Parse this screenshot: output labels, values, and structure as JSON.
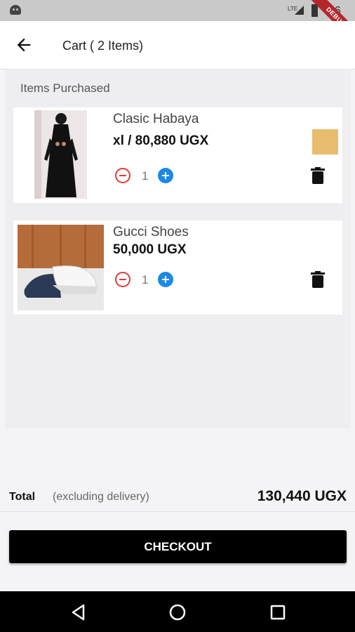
{
  "status_bar": {
    "time": "36",
    "network": "LTE"
  },
  "debug_banner": "DEBUG",
  "app_bar": {
    "title": "Cart ( 2 Items)"
  },
  "section_label": "Items Purchased",
  "items": [
    {
      "name": "Clasic Habaya",
      "price": "xl / 80,880 UGX",
      "quantity": "1",
      "color_swatch": "#e8bc6e"
    },
    {
      "name": "Gucci Shoes",
      "price": "50,000 UGX",
      "quantity": "1"
    }
  ],
  "total": {
    "label": "Total",
    "note": "(excluding delivery)",
    "amount": "130,440 UGX"
  },
  "checkout_label": "CHECKOUT",
  "colors": {
    "minus": "#e53935",
    "plus": "#1e88e5",
    "checkout_bg": "#000000",
    "swatch": "#e8bc6e"
  },
  "icons": [
    "back-arrow-icon",
    "minus-circle-icon",
    "plus-circle-icon",
    "trash-icon",
    "nav-back-icon",
    "nav-home-icon",
    "nav-recents-icon"
  ]
}
